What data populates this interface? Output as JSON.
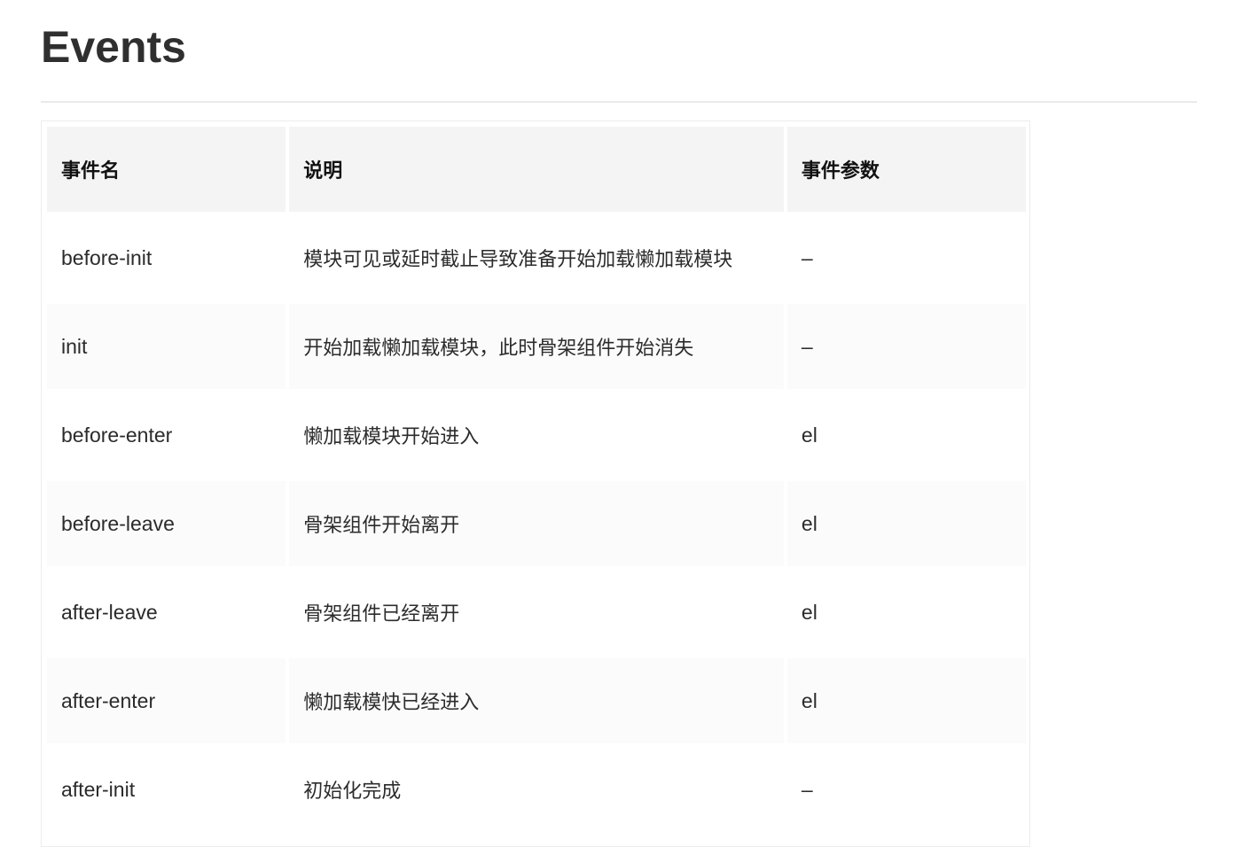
{
  "page": {
    "title": "Events"
  },
  "events_table": {
    "headers": [
      "事件名",
      "说明",
      "事件参数"
    ],
    "rows": [
      {
        "name": "before-init",
        "description": "模块可见或延时截止导致准备开始加载懒加载模块",
        "params": "–"
      },
      {
        "name": "init",
        "description": "开始加载懒加载模块，此时骨架组件开始消失",
        "params": "–"
      },
      {
        "name": "before-enter",
        "description": "懒加载模块开始进入",
        "params": "el"
      },
      {
        "name": "before-leave",
        "description": "骨架组件开始离开",
        "params": "el"
      },
      {
        "name": "after-leave",
        "description": "骨架组件已经离开",
        "params": "el"
      },
      {
        "name": "after-enter",
        "description": "懒加载模快已经进入",
        "params": "el"
      },
      {
        "name": "after-init",
        "description": "初始化完成",
        "params": "–"
      }
    ]
  },
  "colors": {
    "header_bg": "#f4f4f4",
    "row_alt_bg": "#fbfbfb",
    "text": "#2c2c2c",
    "divider": "#eaeaea"
  }
}
